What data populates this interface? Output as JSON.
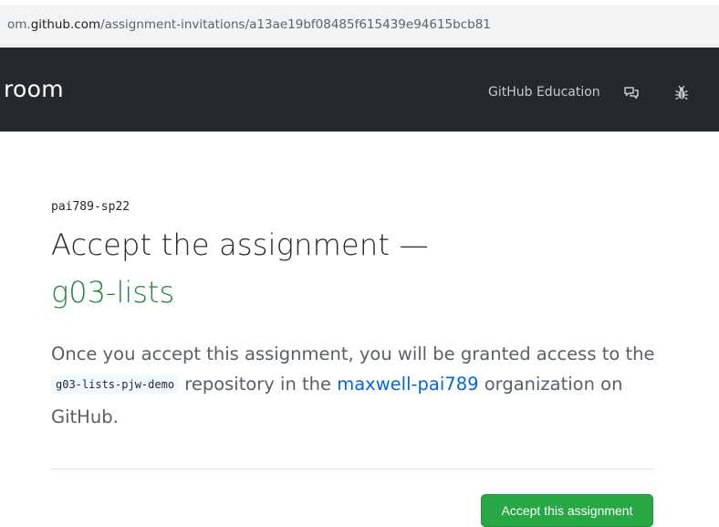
{
  "browser": {
    "url_prefix": "om.",
    "url_host": "github.com",
    "url_path": "/assignment-invitations/a13ae19bf08485f615439e94615bcb81"
  },
  "navbar": {
    "brand": "room",
    "education_link": "GitHub Education",
    "icons": [
      "feedback-icon",
      "bug-icon"
    ]
  },
  "assignment": {
    "org_name": "pai789-sp22",
    "title": "Accept the assignment —",
    "assignment_name": "g03-lists",
    "description": {
      "part1": "Once you accept this assignment, you will be granted access to the ",
      "repo": "g03-lists-pjw-demo",
      "part2": " repository in the ",
      "org_link": "maxwell-pai789",
      "part3": " organization on GitHub."
    },
    "accept_button": "Accept this assignment"
  },
  "colors": {
    "navbar_bg": "#24292e",
    "accent_green": "#28a745",
    "link_blue": "#0366d6",
    "title_green": "#22863a"
  }
}
